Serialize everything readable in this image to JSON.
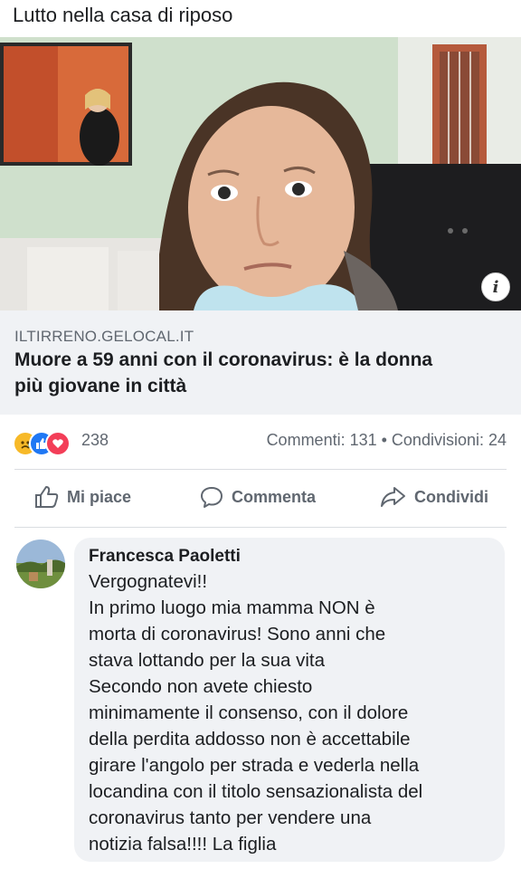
{
  "post": {
    "text": "Lutto nella casa di riposo"
  },
  "link_preview": {
    "domain": "ILTIRRENO.GELOCAL.IT",
    "title_lines": [
      "Muore a 59 anni con il coronavirus: è la donna",
      "più giovane in città"
    ],
    "info_icon": "info-icon"
  },
  "stats": {
    "reactions": [
      "sad",
      "like",
      "love"
    ],
    "reaction_count": "238",
    "comments_shares": "Commenti: 131 • Condivisioni: 24"
  },
  "actions": {
    "like": "Mi piace",
    "comment": "Commenta",
    "share": "Condividi"
  },
  "comment": {
    "author": "Francesca Paoletti",
    "lines": [
      "Vergognatevi!!",
      "In primo luogo mia mamma NON è",
      "morta di coronavirus! Sono anni che",
      "stava lottando per la sua vita",
      "Secondo non avete chiesto",
      "minimamente il consenso, con il dolore",
      "della perdita addosso non è accettabile",
      "girare l'angolo per strada e vederla nella",
      "locandina con il titolo sensazionalista del",
      "coronavirus tanto per vendere una",
      "notizia falsa!!!! La figlia"
    ]
  },
  "colors": {
    "link_box_bg": "#f0f2f5",
    "secondary_text": "#606770",
    "like_blue": "#2078f4",
    "love_red": "#f33e58",
    "sad_yellow": "#f7b928"
  }
}
